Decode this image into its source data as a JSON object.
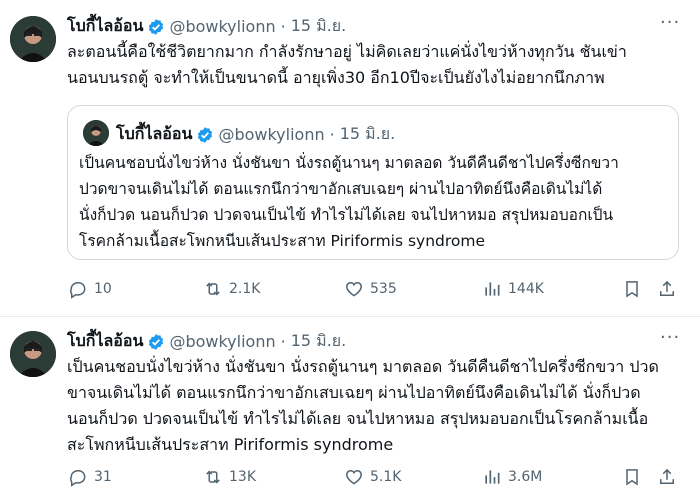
{
  "tweet1": {
    "author_name": "โบกี้ไลอ้อน",
    "handle": "@bowkylionn",
    "date": "15 มิ.ย.",
    "text_lines": [
      "ละตอนนี้คือใช้ชีวิตยากมาก กำลังรักษาอยู่ ไม่คิดเลยว่าแค่นั่งไขว่ห้างทุกวัน ชันเข่า",
      "นอนบนรถตู้ จะทำให้เป็นขนาดนี้ อายุเพิ่ง30 อีก10ปีจะเป็นยังไงไม่อยากนึกภาพ"
    ],
    "quote": {
      "author_name": "โบกี้ไลอ้อน",
      "handle": "@bowkylionn",
      "date": "15 มิ.ย.",
      "text_lines": [
        "เป็นคนชอบนั่งไขว่ห้าง นั่งชันขา นั่งรถตู้นานๆ มาตลอด วันดีคืนดีชาไปครึ่งซีกขวา",
        "ปวดขาจนเดินไม่ได้ ตอนแรกนึกว่าขาอักเสบเฉยๆ ผ่านไปอาทิตย์นึงคือเดินไม่ได้",
        "นั่งก็ปวด นอนก็ปวด ปวดจนเป็นไข้ ทำไรไม่ได้เลย จนไปหาหมอ สรุปหมอบอกเป็น",
        "โรคกล้ามเนื้อสะโพกหนีบเส้นประสาท Piriformis syndrome"
      ]
    },
    "stats": {
      "replies": "10",
      "reposts": "2.1K",
      "likes": "535",
      "views": "144K"
    }
  },
  "tweet2": {
    "author_name": "โบกี้ไลอ้อน",
    "handle": "@bowkylionn",
    "date": "15 มิ.ย.",
    "text_lines": [
      "เป็นคนชอบนั่งไขว่ห้าง นั่งชันขา นั่งรถตู้นานๆ มาตลอด วันดีคืนดีชาไปครึ่งซีกขวา ปวด",
      "ขาจนเดินไม่ได้ ตอนแรกนึกว่าขาอักเสบเฉยๆ ผ่านไปอาทิตย์นึงคือเดินไม่ได้ นั่งก็ปวด",
      "นอนก็ปวด ปวดจนเป็นไข้ ทำไรไม่ได้เลย จนไปหาหมอ สรุปหมอบอกเป็นโรคกล้ามเนื้อ",
      "สะโพกหนีบเส้นประสาท Piriformis syndrome"
    ],
    "stats": {
      "replies": "31",
      "reposts": "13K",
      "likes": "5.1K",
      "views": "3.6M"
    }
  },
  "colors": {
    "verified": "#1d9bf0",
    "muted": "#536471",
    "border": "#cfd9de"
  }
}
